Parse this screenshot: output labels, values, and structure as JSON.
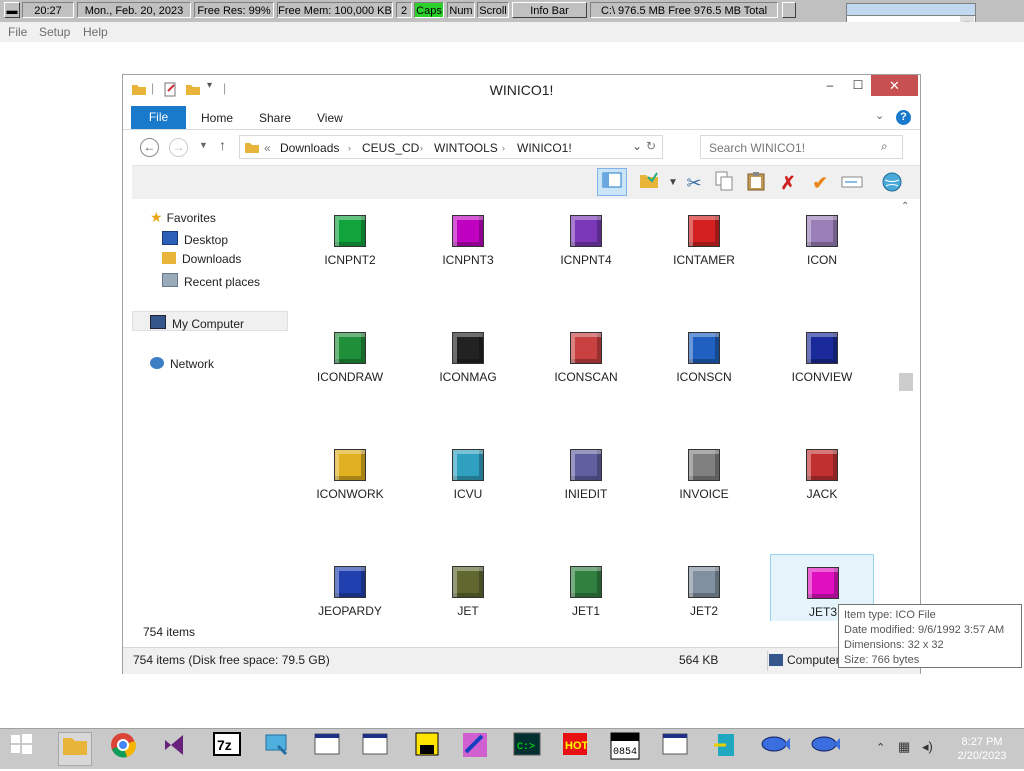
{
  "infobar": {
    "time": "20:27",
    "date": "Mon., Feb. 20, 2023",
    "free_res": "Free Res: 99%",
    "free_mem": "Free Mem: 100,000 KB",
    "number": "2",
    "caps": "Caps",
    "num": "Num",
    "scroll": "Scroll",
    "info_bar_button": "Info Bar",
    "disk": "C:\\ 976.5 MB Free  976.5 MB Total"
  },
  "app_menu": {
    "file": "File",
    "setup": "Setup",
    "help": "Help"
  },
  "window": {
    "title": "WINICO1!",
    "ribbon_tabs": {
      "file": "File",
      "home": "Home",
      "share": "Share",
      "view": "View"
    },
    "breadcrumb": [
      "Downloads",
      "CEUS_CD",
      "WINTOOLS",
      "WINICO1!"
    ],
    "breadcrumb_prefix": "«",
    "search_placeholder": "Search WINICO1!",
    "navpane": {
      "favorites": "Favorites",
      "desktop": "Desktop",
      "downloads": "Downloads",
      "recent_places": "Recent places",
      "my_computer": "My Computer",
      "network": "Network"
    },
    "files": [
      {
        "name": "ICNPNT2",
        "color": "#11a43c"
      },
      {
        "name": "ICNPNT3",
        "color": "#c000c0"
      },
      {
        "name": "ICNPNT4",
        "color": "#7a38b8"
      },
      {
        "name": "ICNTAMER",
        "color": "#d42020"
      },
      {
        "name": "ICON",
        "color": "#9a7fb8"
      },
      {
        "name": "ICONDRAW",
        "color": "#1f8f3a"
      },
      {
        "name": "ICONMAG",
        "color": "#222222"
      },
      {
        "name": "ICONSCAN",
        "color": "#c84040"
      },
      {
        "name": "ICONSCN",
        "color": "#2060c0"
      },
      {
        "name": "ICONVIEW",
        "color": "#1a2a9a"
      },
      {
        "name": "ICONWORK",
        "color": "#e0b020"
      },
      {
        "name": "ICVU",
        "color": "#30a0c0"
      },
      {
        "name": "INIEDIT",
        "color": "#6060a0"
      },
      {
        "name": "INVOICE",
        "color": "#808080"
      },
      {
        "name": "JACK",
        "color": "#c03030"
      },
      {
        "name": "JEOPARDY",
        "color": "#2040b0"
      },
      {
        "name": "JET",
        "color": "#606830"
      },
      {
        "name": "JET1",
        "color": "#308040"
      },
      {
        "name": "JET2",
        "color": "#8090a0"
      },
      {
        "name": "JET3",
        "color": "#e010c0"
      }
    ],
    "item_count": "754 items",
    "status_left": "754 items (Disk free space: 79.5 GB)",
    "status_size": "564 KB",
    "status_computer": "Computer"
  },
  "tooltip": {
    "type": "Item type: ICO File",
    "modified": "Date modified: 9/6/1992 3:57 AM",
    "dimensions": "Dimensions: 32 x 32",
    "size": "Size: 766 bytes"
  },
  "clock": {
    "time": "8:27 PM",
    "date": "2/20/2023"
  },
  "colors": {
    "accent": "#1979ca",
    "close": "#c75050",
    "selection": "#e5f3fb"
  }
}
